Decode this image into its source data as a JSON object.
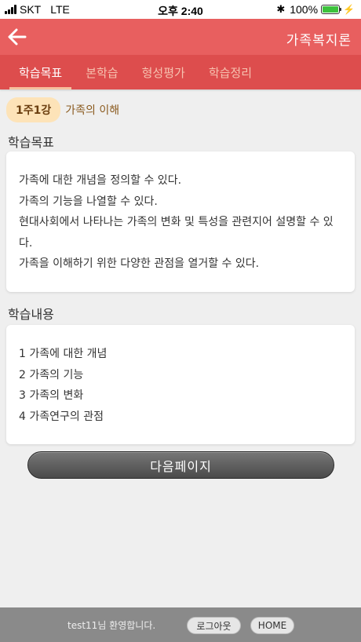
{
  "status_bar": {
    "carrier": "SKT",
    "network": "LTE",
    "time": "오후 2:40",
    "battery": "100%",
    "battery_level": 1.0
  },
  "header": {
    "title": "가족복지론",
    "back_icon": "arrow-left-icon"
  },
  "tabs": [
    {
      "label": "학습목표",
      "active": true
    },
    {
      "label": "본학습",
      "active": false
    },
    {
      "label": "형성평가",
      "active": false
    },
    {
      "label": "학습정리",
      "active": false
    }
  ],
  "lesson": {
    "badge": "1주1강",
    "title": "가족의 이해"
  },
  "goals": {
    "heading": "학습목표",
    "items": [
      "가족에 대한 개념을 정의할 수 있다.",
      "가족의 기능을 나열할 수 있다.",
      "현대사회에서 나타나는 가족의 변화 및 특성을 관련지어 설명할 수 있다.",
      "가족을 이해하기 위한 다양한 관점을 열거할 수 있다."
    ]
  },
  "contents": {
    "heading": "학습내용",
    "items": [
      "1 가족에 대한 개념",
      "2 가족의 기능",
      "3 가족의 변화",
      "4 가족연구의 관점"
    ]
  },
  "next_button": "다음페이지",
  "footer": {
    "welcome": "test11님 환영합니다.",
    "logout": "로그아웃",
    "home": "HOME"
  },
  "colors": {
    "header": "#e85f5f",
    "tab_bar": "#dd4d4d",
    "chip": "#fde3b8"
  }
}
